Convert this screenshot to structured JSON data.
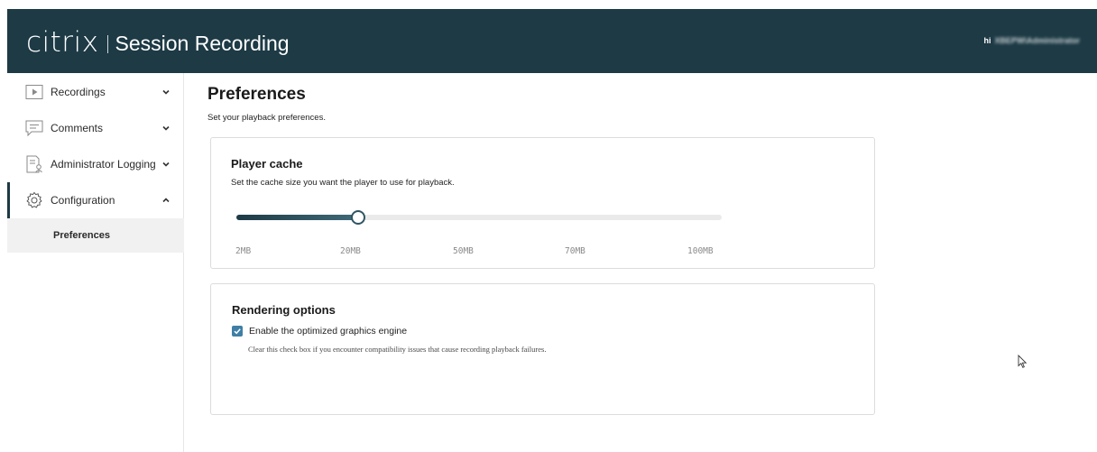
{
  "header": {
    "brand_logo": "citrix",
    "product_name": "Session Recording",
    "user_greeting": "hi",
    "user_name": "XBEPW\\Administrator",
    "background_color": "#1d3a45"
  },
  "sidebar": {
    "items": [
      {
        "label": "Recordings",
        "icon": "play-icon",
        "chevron": "chevron-down"
      },
      {
        "label": "Comments",
        "icon": "comment-icon",
        "chevron": "chevron-down"
      },
      {
        "label": "Administrator Logging",
        "icon": "log-icon",
        "chevron": "chevron-down"
      },
      {
        "label": "Configuration",
        "icon": "gear-icon",
        "chevron": "chevron-up",
        "active": true
      }
    ],
    "subitems": [
      {
        "label": "Preferences",
        "selected": true
      }
    ]
  },
  "main": {
    "title": "Preferences",
    "subtitle": "Set your playback preferences."
  },
  "player_cache": {
    "title": "Player cache",
    "description": "Set the cache size you want the player to use for playback.",
    "options": [
      "2MB",
      "20MB",
      "50MB",
      "70MB",
      "100MB"
    ],
    "selected": "20MB",
    "selected_index": 1
  },
  "rendering": {
    "title": "Rendering options",
    "checkbox_label": "Enable the optimized graphics engine",
    "checkbox_checked": true,
    "help_text": "Clear this check box if you encounter compatibility issues that cause recording playback failures."
  },
  "colors": {
    "accent": "#1d3a45",
    "checkbox": "#3f7fa6"
  }
}
